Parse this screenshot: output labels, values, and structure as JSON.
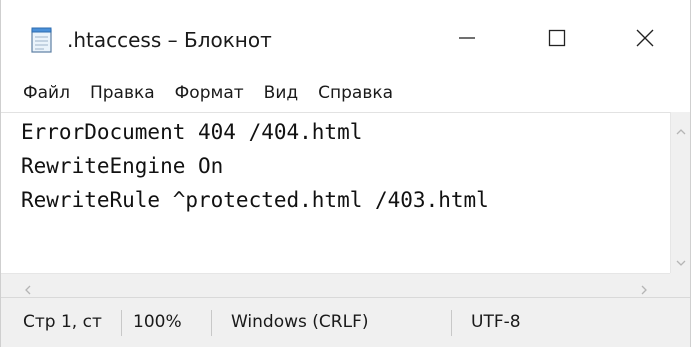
{
  "window": {
    "title": ".htaccess – Блокнот",
    "icon": "notepad-icon"
  },
  "titlebar_buttons": {
    "minimize": "minimize-icon",
    "maximize": "maximize-icon",
    "close": "close-icon"
  },
  "menu": {
    "items": [
      "Файл",
      "Правка",
      "Формат",
      "Вид",
      "Справка"
    ]
  },
  "editor": {
    "lines": [
      "ErrorDocument 404 /404.html",
      "RewriteEngine On",
      "RewriteRule ^protected.html /403.html"
    ]
  },
  "status": {
    "position": "Стр 1, ст",
    "zoom": "100%",
    "line_endings": "Windows (CRLF)",
    "encoding": "UTF-8"
  },
  "colors": {
    "background": "#ffffff",
    "statusbar": "#f0f0f0",
    "scrollbar": "#f0f0f0",
    "text": "#1a1a1a"
  }
}
